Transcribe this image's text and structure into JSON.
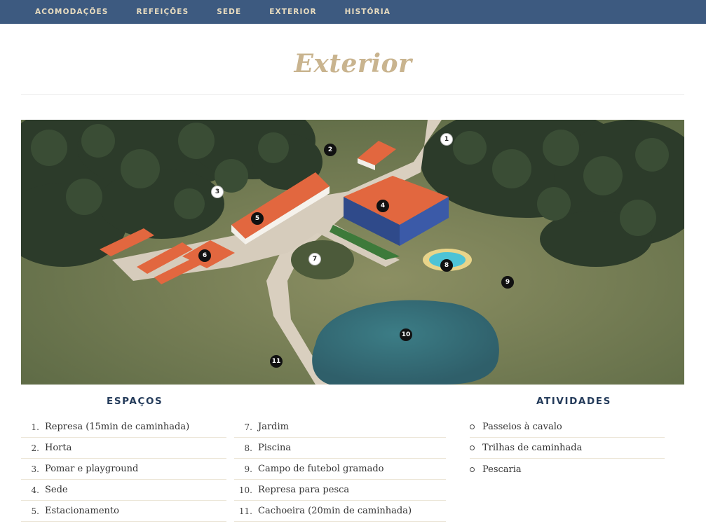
{
  "nav": {
    "items": [
      {
        "label": "ACOMODAÇÕES"
      },
      {
        "label": "REFEIÇÕES"
      },
      {
        "label": "SEDE"
      },
      {
        "label": "EXTERIOR"
      },
      {
        "label": "HISTÓRIA"
      }
    ]
  },
  "page": {
    "title": "Exterior"
  },
  "map": {
    "markers": [
      "1",
      "2",
      "3",
      "4",
      "5",
      "6",
      "7",
      "8",
      "9",
      "10",
      "11"
    ]
  },
  "espacos": {
    "title": "ESPAÇOS",
    "col1": [
      {
        "num": "1.",
        "label": "Represa (15min de caminhada)"
      },
      {
        "num": "2.",
        "label": "Horta"
      },
      {
        "num": "3.",
        "label": "Pomar e playground"
      },
      {
        "num": "4.",
        "label": "Sede"
      },
      {
        "num": "5.",
        "label": "Estacionamento"
      }
    ],
    "col2": [
      {
        "num": "7.",
        "label": "Jardim"
      },
      {
        "num": "8.",
        "label": "Piscina"
      },
      {
        "num": "9.",
        "label": "Campo de futebol gramado"
      },
      {
        "num": "10.",
        "label": "Represa para pesca"
      },
      {
        "num": "11.",
        "label": "Cachoeira (20min de caminhada)"
      }
    ]
  },
  "atividades": {
    "title": "ATIVIDADES",
    "items": [
      {
        "label": "Passeios à cavalo"
      },
      {
        "label": "Trilhas de caminhada"
      },
      {
        "label": "Pescaria"
      }
    ]
  },
  "colors": {
    "nav_bg": "#3d5a80",
    "nav_text": "#e8dcc0",
    "title": "#c9b48f",
    "heading": "#243b5a"
  }
}
